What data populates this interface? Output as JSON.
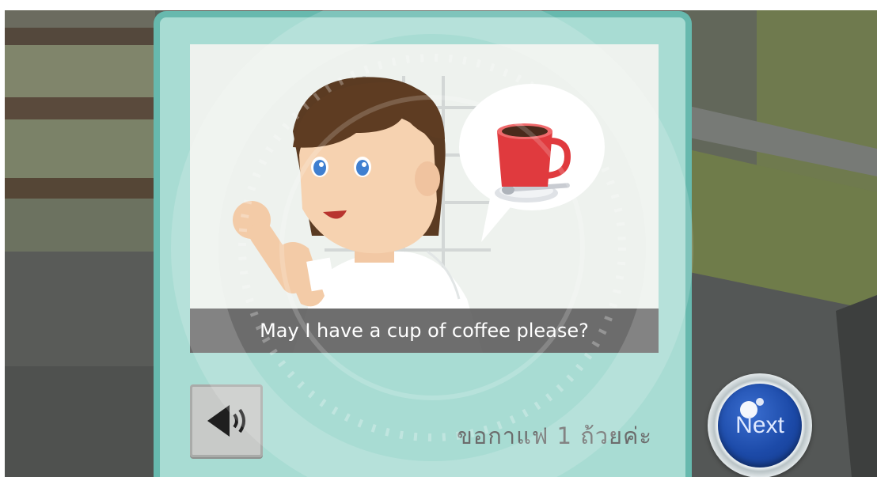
{
  "caption": {
    "english": "May I have a cup of coffee please?"
  },
  "translation": {
    "thai": "ขอกาแฟ 1 ถ้วยค่ะ"
  },
  "controls": {
    "next_label": "Next",
    "sound_icon": "speaker-icon"
  },
  "colors": {
    "card_bg": "#a8dcd3",
    "card_border": "#67b9ae",
    "caption_bg": "#565656",
    "next_button": "#1c4aa8",
    "cup": "#e03a3e"
  }
}
